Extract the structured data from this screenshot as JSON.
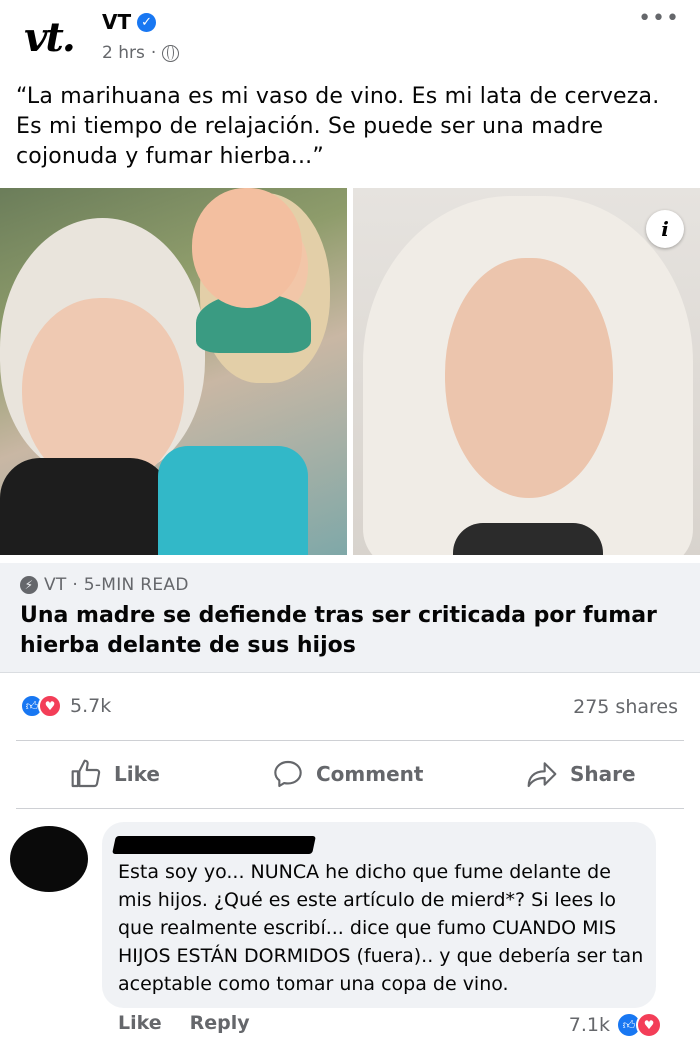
{
  "post": {
    "page_name": "VT",
    "avatar_text": "vt.",
    "time": "2 hrs",
    "separator": "·",
    "more": "•••",
    "text": "“La marihuana es mi vaso de vino. Es mi lata de cerveza. Es mi tiempo de relajación. Se puede ser una madre cojonuda y fumar hierba...”"
  },
  "photos": {
    "info_icon": "i"
  },
  "link": {
    "source": "VT · 5-MIN READ",
    "title": "Una madre se defiende tras ser criticada por fumar hierba delante de sus hijos"
  },
  "stats": {
    "reaction_count": "5.7k",
    "shares": "275 shares"
  },
  "actions": {
    "like": "Like",
    "comment": "Comment",
    "share": "Share"
  },
  "comment": {
    "text": "Esta soy yo... NUNCA he dicho que fume delante de mis hijos. ¿Qué es este artículo de mierd*? Si lees lo que realmente escribí... dice que fumo CUANDO MIS HIJOS ESTÁN DORMIDOS (fuera).. y que debería ser tan aceptable como tomar una copa de vino.",
    "like": "Like",
    "reply": "Reply",
    "reaction_count": "7.1k"
  },
  "colors": {
    "facebook_blue": "#1877f2",
    "love_red": "#f33e58",
    "secondary_text": "#65676b",
    "card_bg": "#f0f2f5"
  }
}
